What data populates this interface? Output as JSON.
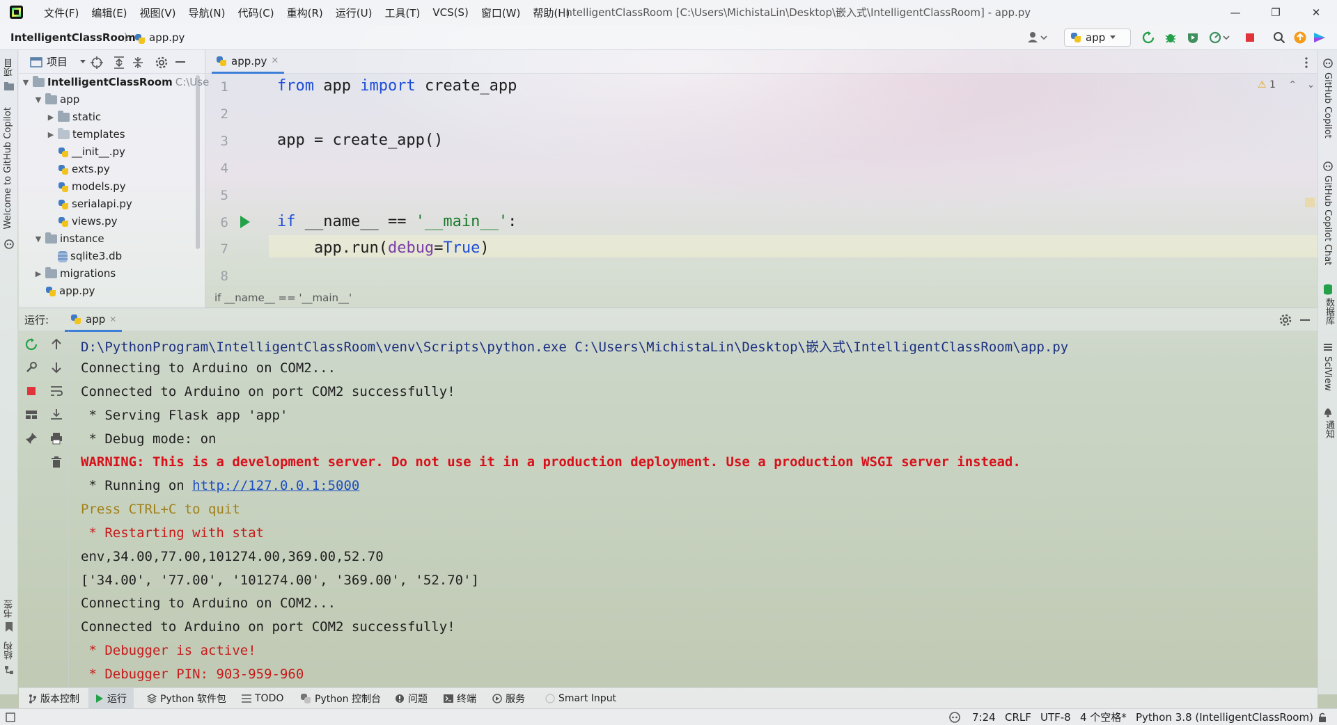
{
  "window": {
    "title": "IntelligentClassRoom [C:\\Users\\MichistaLin\\Desktop\\嵌入式\\IntelligentClassRoom] - app.py",
    "minimize": "—",
    "restore": "❐",
    "close": "✕"
  },
  "menu": [
    "文件(F)",
    "编辑(E)",
    "视图(V)",
    "导航(N)",
    "代码(C)",
    "重构(R)",
    "运行(U)",
    "工具(T)",
    "VCS(S)",
    "窗口(W)",
    "帮助(H)"
  ],
  "nav": {
    "project": "IntelligentClassRoom",
    "separator": "〉",
    "file": "app.py",
    "run_config": "app"
  },
  "left_strip": {
    "project": "项目",
    "copilot": "Welcome to GitHub Copilot",
    "bookmarks": "书签",
    "structure": "结构"
  },
  "right_strip": {
    "copilot": "GitHub Copilot",
    "copilot_chat": "GitHub Copilot Chat",
    "database": "数据库",
    "sciview": "SciView",
    "notifications": "通知"
  },
  "project_panel": {
    "title": "项目",
    "tree": [
      {
        "label": "IntelligentClassRoom",
        "hint": "C:\\Use",
        "type": "folder",
        "level": 0,
        "expanded": true
      },
      {
        "label": "app",
        "type": "folder",
        "level": 1,
        "expanded": true
      },
      {
        "label": "static",
        "type": "folder",
        "level": 2,
        "expanded": false
      },
      {
        "label": "templates",
        "type": "folder",
        "level": 2,
        "expanded": false
      },
      {
        "label": "__init__.py",
        "type": "py",
        "level": 2
      },
      {
        "label": "exts.py",
        "type": "py",
        "level": 2
      },
      {
        "label": "models.py",
        "type": "py",
        "level": 2
      },
      {
        "label": "serialapi.py",
        "type": "py",
        "level": 2
      },
      {
        "label": "views.py",
        "type": "py",
        "level": 2
      },
      {
        "label": "instance",
        "type": "folder",
        "level": 1,
        "expanded": true
      },
      {
        "label": "sqlite3.db",
        "type": "db",
        "level": 2
      },
      {
        "label": "migrations",
        "type": "folder",
        "level": 1,
        "expanded": false
      },
      {
        "label": "app.py",
        "type": "py",
        "level": 1
      }
    ]
  },
  "editor": {
    "tab": "app.py",
    "warning_count": "1",
    "line_numbers": [
      "1",
      "2",
      "3",
      "4",
      "5",
      "6",
      "7",
      "8"
    ],
    "code": {
      "l1_kw1": "from",
      "l1_a": " app ",
      "l1_kw2": "import",
      "l1_b": " create_app",
      "l3": "app = create_app()",
      "l6_kw": "if",
      "l6_a": " __name__ == ",
      "l6_str": "'__main__'",
      "l6_b": ":",
      "l7_a": "    app.run(",
      "l7_param": "debug",
      "l7_b": "=",
      "l7_kw": "True",
      "l7_c": ")"
    },
    "breadcrumb": "if __name__ == '__main__'"
  },
  "run_panel": {
    "label": "运行:",
    "tab": "app",
    "console": {
      "path": "D:\\PythonProgram\\IntelligentClassRoom\\venv\\Scripts\\python.exe C:\\Users\\MichistaLin\\Desktop\\嵌入式\\IntelligentClassRoom\\app.py",
      "l2": "Connecting to Arduino on COM2...",
      "l3": "Connected to Arduino on port COM2 successfully!",
      "l4": " * Serving Flask app 'app'",
      "l5": " * Debug mode: on",
      "l6": "WARNING: This is a development server. Do not use it in a production deployment. Use a production WSGI server instead.",
      "l7_prefix": " * Running on ",
      "l7_link": "http://127.0.0.1:5000",
      "l8": "Press CTRL+C to quit",
      "l9": " * Restarting with stat",
      "l10": "env,34.00,77.00,101274.00,369.00,52.70",
      "l11": "['34.00', '77.00', '101274.00', '369.00', '52.70']",
      "l12": "Connecting to Arduino on COM2...",
      "l13": "Connected to Arduino on port COM2 successfully!",
      "l14": " * Debugger is active!",
      "l15": " * Debugger PIN: 903-959-960"
    }
  },
  "tool_windows": [
    "版本控制",
    "运行",
    "Python 软件包",
    "TODO",
    "Python 控制台",
    "问题",
    "终端",
    "服务",
    "Smart Input"
  ],
  "status": {
    "position": "7:24",
    "line_sep": "CRLF",
    "encoding": "UTF-8",
    "indent": "4 个空格*",
    "interpreter": "Python 3.8 (IntelligentClassRoom)"
  },
  "colors": {
    "keyword": "#1e4ed8",
    "string": "#187a28",
    "error": "#d8101a",
    "accent": "#3d7fd8",
    "run_green": "#24a148"
  }
}
